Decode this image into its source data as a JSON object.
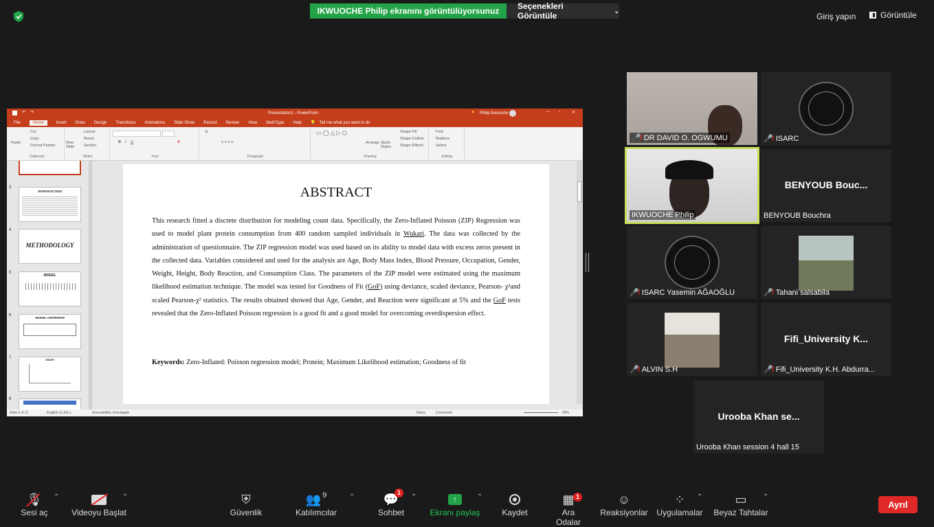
{
  "top": {
    "share_banner": "IKWUOCHE Philip ekranını görüntülüyorsunuz",
    "view_options": "Seçenekleri Görüntüle",
    "sign_in": "Giriş yapın",
    "view": "Görüntüle"
  },
  "ppt": {
    "title": "Presentation1 - PowerPoint",
    "user": "Philip Ikwuoche",
    "tabs": [
      "File",
      "Home",
      "Insert",
      "Draw",
      "Design",
      "Transitions",
      "Animations",
      "Slide Show",
      "Record",
      "Review",
      "View",
      "MathType",
      "Help"
    ],
    "search": "Tell me what you want to do",
    "ribbon_groups": [
      "Clipboard",
      "Slides",
      "Font",
      "Paragraph",
      "Drawing",
      "Editing"
    ],
    "clipboard": {
      "cut": "Cut",
      "copy": "Copy",
      "paste": "Paste",
      "format_painter": "Format Painter"
    },
    "slides_group": {
      "new_slide": "New Slide",
      "layout": "Layout",
      "reset": "Reset",
      "section": "Section"
    },
    "editing": {
      "find": "Find",
      "replace": "Replace",
      "select": "Select"
    },
    "drawing": {
      "arrange": "Arrange",
      "quick_styles": "Quick Styles",
      "shape_fill": "Shape Fill",
      "shape_outline": "Shape Outline",
      "shape_effects": "Shape Effects"
    },
    "thumbnails": [
      {
        "num": "3",
        "title": "INTRODUCTION"
      },
      {
        "num": "4",
        "title": "METHODOLOGY"
      },
      {
        "num": "5",
        "title": "MODEL"
      },
      {
        "num": "6",
        "title": "MODEL CRITERION"
      },
      {
        "num": "7",
        "title": "GRAPH"
      },
      {
        "num": "8",
        "title": ""
      }
    ],
    "slide_title": "ABSTRACT",
    "abstract_parts": {
      "p1": "This research fitted a discrete distribution for modeling count data. Specifically, the Zero-Inflated Poisson (ZIP) Regression was used to model plant protein consumption from 400 random sampled individuals in ",
      "wukari": "Wukari",
      "p2": ". The data was collected by the administration of questionnaire. The ZIP regression model was used based on its ability to model data with excess zeros present in the collected data. Variables considered and used for the analysis are Age, Body Mass Index, Blood Pressure, Occupation, Gender, Weight, Height, Body Reaction, and Consumption Class. The parameters of the ZIP model were estimated using the maximum likelihood estimation technique. The model was tested for Goodness of Fit (",
      "gof1": "GoF",
      "p3": ") using deviance, scaled deviance, Pearson- χ²and scaled Pearson-χ² statistics. The results obtained showed that Age, Gender, and Reaction were significant at 5% and the ",
      "gof2": "GoF",
      "p4": " tests revealed that the Zero-Inflated Poisson regression is a good fit and a good model for overcoming overdispersion effect."
    },
    "keywords_label": "Keywords:",
    "keywords": " Zero-Inflated: Poisson regression model; Protein; Maximum Likelihood estimation; Goodness of fit",
    "status": {
      "slide": "Slide 2 of 11",
      "lang": "English (U.A.E.)",
      "accessibility": "Accessibility: Investigate",
      "notes": "Notes",
      "comments": "Comments",
      "zoom": "99%"
    }
  },
  "participants": [
    {
      "name": "DR DAVID O. OGWUMU",
      "big": ""
    },
    {
      "name": "ISARC",
      "big": ""
    },
    {
      "name": "IKWUOCHE Philip",
      "big": ""
    },
    {
      "name": "BENYOUB Bouchra",
      "big": "BENYOUB  Bouc..."
    },
    {
      "name": "ISARC Yasemin AĞAOĞLU",
      "big": ""
    },
    {
      "name": "Tahani salsabila",
      "big": ""
    },
    {
      "name": "ALVIN S.H",
      "big": ""
    },
    {
      "name": "Fifi_University K.H. Abdurra...",
      "big": "Fifi_University  K..."
    },
    {
      "name": "Urooba Khan session 4 hall 15",
      "big": "Urooba  Khan  se..."
    }
  ],
  "toolbar": {
    "mute": "Sesi aç",
    "video": "Videoyu Başlat",
    "security": "Güvenlik",
    "participants": "Katılımcılar",
    "participants_count": "9",
    "chat": "Sohbet",
    "chat_badge": "1",
    "share": "Ekranı paylaş",
    "record": "Kaydet",
    "breakout": "Ara Odalar",
    "breakout_badge": "1",
    "reactions": "Reaksiyonlar",
    "apps": "Uygulamalar",
    "whiteboards": "Beyaz Tahtalar",
    "leave": "Ayrıl"
  },
  "colors": {
    "accent_green": "#24a448",
    "ppt_red": "#c43e1c",
    "leave_red": "#e02828",
    "active_speaker": "#c6e05a"
  }
}
